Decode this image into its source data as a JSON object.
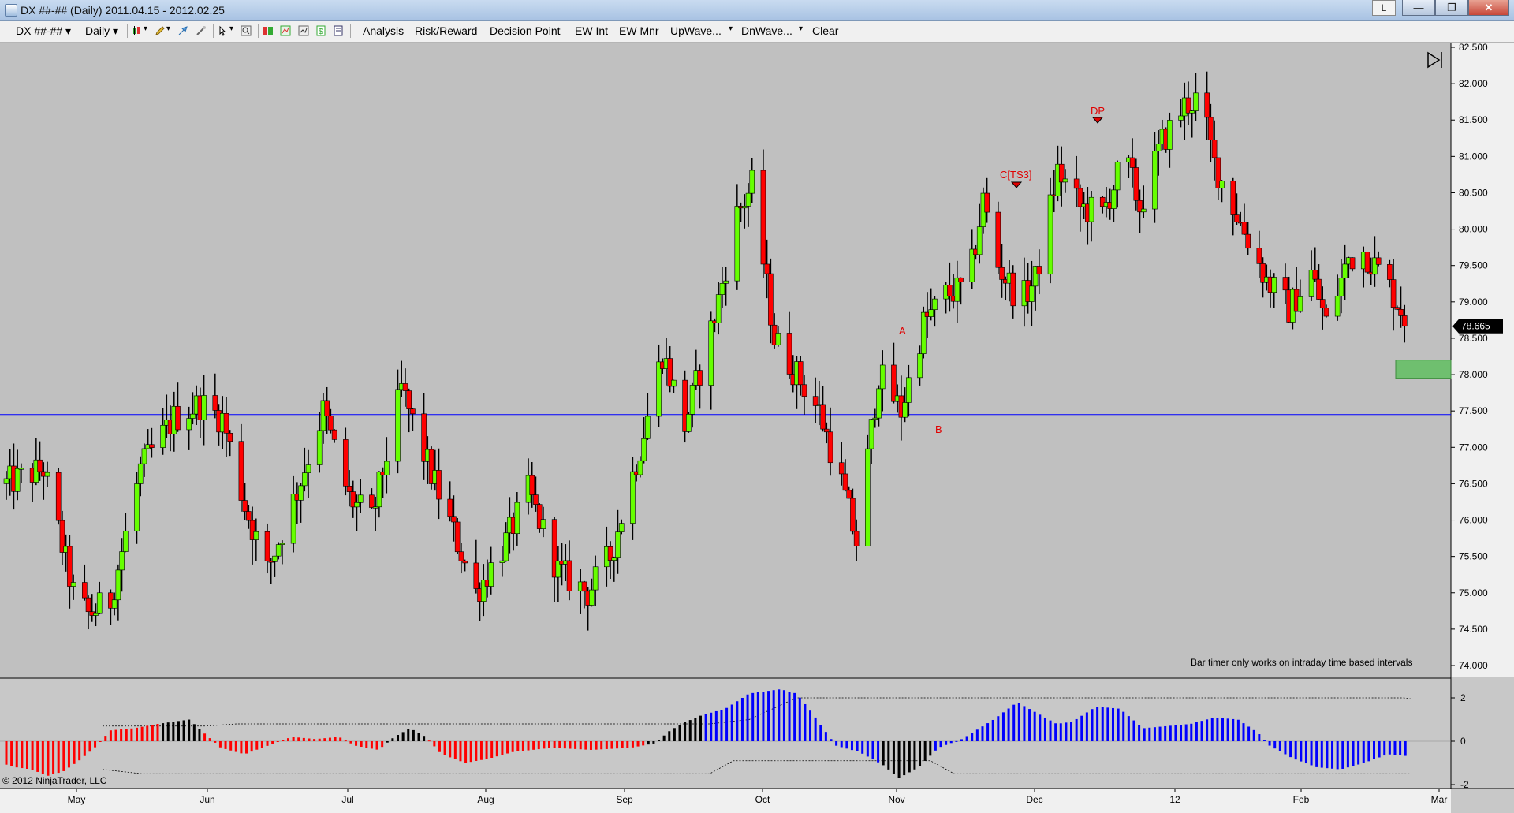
{
  "window": {
    "title": "DX ##-## (Daily)  2011.04.15 - 2012.02.25",
    "layout_button": "L",
    "minimize": "—",
    "maximize": "❐",
    "close": "✕"
  },
  "toolbar": {
    "instrument": "DX ##-##",
    "interval": "Daily",
    "menu_items": [
      "Analysis",
      "Risk/Reward",
      "Decision Point",
      "EW Int",
      "EW Mnr",
      "UpWave...",
      "DnWave...",
      "Clear"
    ]
  },
  "chart": {
    "price_labels": [
      "82.500",
      "82.000",
      "81.500",
      "81.000",
      "80.500",
      "80.000",
      "79.500",
      "79.000",
      "78.500",
      "78.000",
      "77.500",
      "77.000",
      "76.500",
      "76.000",
      "75.500",
      "75.000",
      "74.500",
      "74.000"
    ],
    "current_price": "78.665",
    "indicator_labels": [
      "2",
      "0",
      "-2"
    ],
    "time_labels": [
      "May",
      "Jun",
      "Jul",
      "Aug",
      "Sep",
      "Oct",
      "Nov",
      "Dec",
      "12",
      "Feb",
      "Mar"
    ],
    "markers": {
      "a": "A",
      "b": "B",
      "cts3": "C[TS3]",
      "dp": "DP"
    },
    "bar_timer_message": "Bar timer only works on intraday time based intervals",
    "copyright": "© 2012 NinjaTrader, LLC",
    "colors": {
      "up": "#66ff00",
      "down": "#ff0000",
      "hline": "#0000ff",
      "zone": "#6fbf6f",
      "hist_red": "#ff0000",
      "hist_black": "#000000",
      "hist_blue": "#0000ff"
    }
  }
}
